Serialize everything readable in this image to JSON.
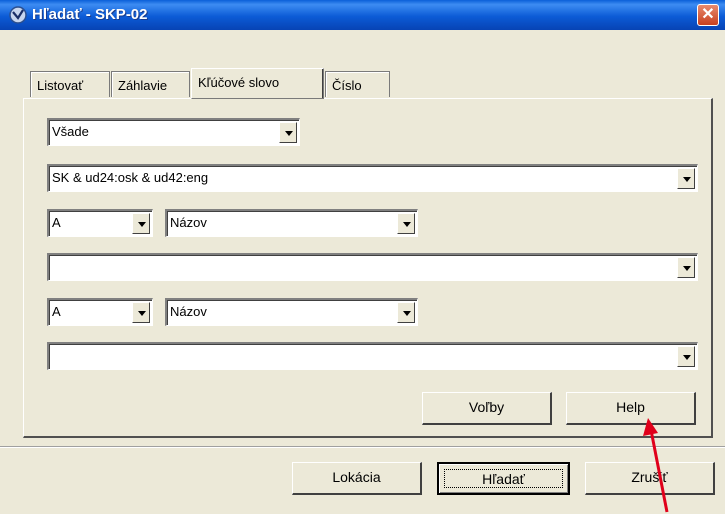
{
  "window": {
    "title": "Hľadať - SKP-02",
    "close_glyph": "✕"
  },
  "tabs": [
    {
      "label": "Listovať",
      "active": false
    },
    {
      "label": "Záhlavie",
      "active": false
    },
    {
      "label": "Kľúčové slovo",
      "active": true
    },
    {
      "label": "Číslo",
      "active": false
    }
  ],
  "search": {
    "scope_select": "Všade",
    "query_1": "SK & ud24:osk & ud42:eng",
    "operator_1": "A",
    "field_1": "Názov",
    "query_2": "",
    "operator_2": "A",
    "field_2": "Názov",
    "query_3": ""
  },
  "panel_buttons": {
    "options": "Voľby",
    "help": "Help"
  },
  "dialog_buttons": {
    "location": "Lokácia",
    "search": "Hľadať",
    "cancel": "Zrušiť"
  },
  "colors": {
    "annotation_arrow": "#e0001a",
    "titlebar": "#0a5fd8",
    "dialog_face": "#ece9d8"
  }
}
